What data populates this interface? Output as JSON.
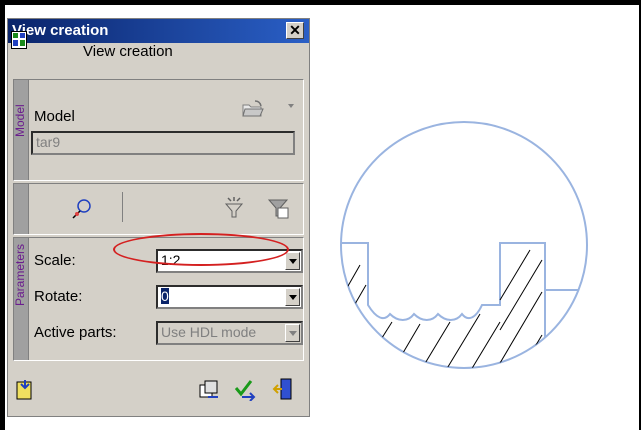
{
  "window": {
    "title": "View creation",
    "close_glyph": "✕",
    "header_label": "View creation"
  },
  "model_section": {
    "tab_label": "Model",
    "label": "Model",
    "value": "tar9"
  },
  "parameters_section": {
    "tab_label": "Parameters",
    "scale_label": "Scale:",
    "scale_value": "1:2",
    "rotate_label": "Rotate:",
    "rotate_value": "0",
    "active_parts_label": "Active parts:",
    "active_parts_value": "Use HDL mode"
  },
  "colors": {
    "titlebar": "#0a246a",
    "vtab_text": "#6b1d8e",
    "highlight": "#d42020",
    "drawing_line": "#9ab4e0"
  },
  "icons": [
    "view-creation-icon",
    "open-folder-icon",
    "pick-element-icon",
    "filter-icon",
    "filter-clear-icon",
    "import-icon",
    "copy-icon",
    "apply-icon",
    "exit-icon"
  ]
}
